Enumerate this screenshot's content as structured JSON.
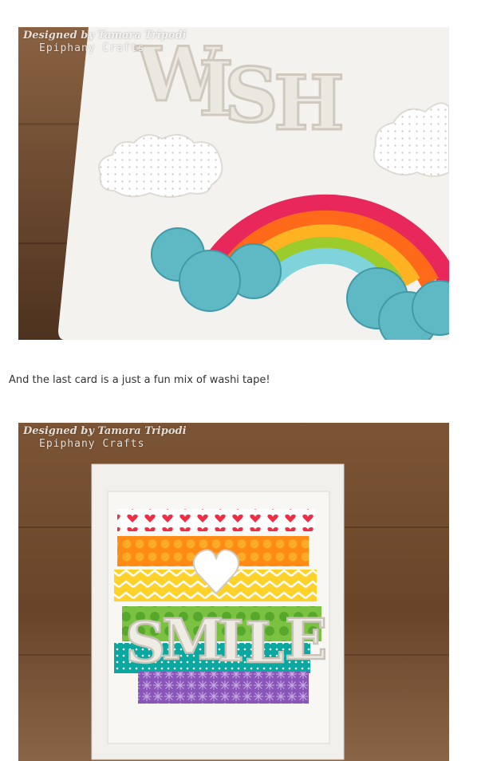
{
  "post": {
    "caption": "And the last card is a just a fun mix of washi tape!",
    "photo1": {
      "watermark_line1": "Designed by Tamara Tripodi",
      "watermark_line2": "Epiphany Crafts",
      "word": "WISH"
    },
    "photo2": {
      "watermark_line1": "Designed by Tamara Tripodi",
      "watermark_line2": "Epiphany Crafts",
      "word": "SMILE"
    }
  },
  "colors": {
    "wood": "#6b4a30",
    "card": "#f3f1ee",
    "rainbow": [
      "#e8275a",
      "#ff6a1a",
      "#ffb323",
      "#9ccc2c",
      "#7fd3da"
    ],
    "cloud_blue": "#5fb9c4",
    "text": "#333333"
  }
}
